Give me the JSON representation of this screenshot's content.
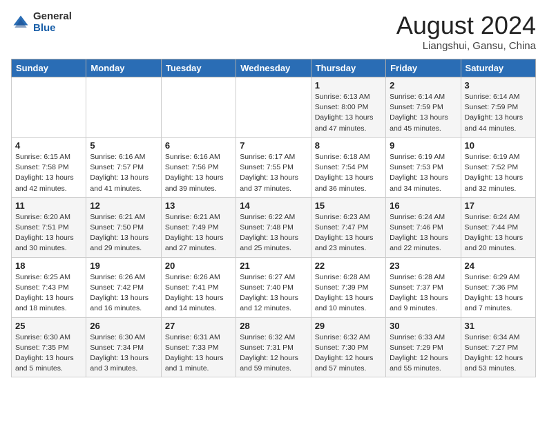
{
  "header": {
    "logo_general": "General",
    "logo_blue": "Blue",
    "month_title": "August 2024",
    "location": "Liangshui, Gansu, China"
  },
  "days_of_week": [
    "Sunday",
    "Monday",
    "Tuesday",
    "Wednesday",
    "Thursday",
    "Friday",
    "Saturday"
  ],
  "weeks": [
    [
      {
        "day": "",
        "info": ""
      },
      {
        "day": "",
        "info": ""
      },
      {
        "day": "",
        "info": ""
      },
      {
        "day": "",
        "info": ""
      },
      {
        "day": "1",
        "info": "Sunrise: 6:13 AM\nSunset: 8:00 PM\nDaylight: 13 hours\nand 47 minutes."
      },
      {
        "day": "2",
        "info": "Sunrise: 6:14 AM\nSunset: 7:59 PM\nDaylight: 13 hours\nand 45 minutes."
      },
      {
        "day": "3",
        "info": "Sunrise: 6:14 AM\nSunset: 7:59 PM\nDaylight: 13 hours\nand 44 minutes."
      }
    ],
    [
      {
        "day": "4",
        "info": "Sunrise: 6:15 AM\nSunset: 7:58 PM\nDaylight: 13 hours\nand 42 minutes."
      },
      {
        "day": "5",
        "info": "Sunrise: 6:16 AM\nSunset: 7:57 PM\nDaylight: 13 hours\nand 41 minutes."
      },
      {
        "day": "6",
        "info": "Sunrise: 6:16 AM\nSunset: 7:56 PM\nDaylight: 13 hours\nand 39 minutes."
      },
      {
        "day": "7",
        "info": "Sunrise: 6:17 AM\nSunset: 7:55 PM\nDaylight: 13 hours\nand 37 minutes."
      },
      {
        "day": "8",
        "info": "Sunrise: 6:18 AM\nSunset: 7:54 PM\nDaylight: 13 hours\nand 36 minutes."
      },
      {
        "day": "9",
        "info": "Sunrise: 6:19 AM\nSunset: 7:53 PM\nDaylight: 13 hours\nand 34 minutes."
      },
      {
        "day": "10",
        "info": "Sunrise: 6:19 AM\nSunset: 7:52 PM\nDaylight: 13 hours\nand 32 minutes."
      }
    ],
    [
      {
        "day": "11",
        "info": "Sunrise: 6:20 AM\nSunset: 7:51 PM\nDaylight: 13 hours\nand 30 minutes."
      },
      {
        "day": "12",
        "info": "Sunrise: 6:21 AM\nSunset: 7:50 PM\nDaylight: 13 hours\nand 29 minutes."
      },
      {
        "day": "13",
        "info": "Sunrise: 6:21 AM\nSunset: 7:49 PM\nDaylight: 13 hours\nand 27 minutes."
      },
      {
        "day": "14",
        "info": "Sunrise: 6:22 AM\nSunset: 7:48 PM\nDaylight: 13 hours\nand 25 minutes."
      },
      {
        "day": "15",
        "info": "Sunrise: 6:23 AM\nSunset: 7:47 PM\nDaylight: 13 hours\nand 23 minutes."
      },
      {
        "day": "16",
        "info": "Sunrise: 6:24 AM\nSunset: 7:46 PM\nDaylight: 13 hours\nand 22 minutes."
      },
      {
        "day": "17",
        "info": "Sunrise: 6:24 AM\nSunset: 7:44 PM\nDaylight: 13 hours\nand 20 minutes."
      }
    ],
    [
      {
        "day": "18",
        "info": "Sunrise: 6:25 AM\nSunset: 7:43 PM\nDaylight: 13 hours\nand 18 minutes."
      },
      {
        "day": "19",
        "info": "Sunrise: 6:26 AM\nSunset: 7:42 PM\nDaylight: 13 hours\nand 16 minutes."
      },
      {
        "day": "20",
        "info": "Sunrise: 6:26 AM\nSunset: 7:41 PM\nDaylight: 13 hours\nand 14 minutes."
      },
      {
        "day": "21",
        "info": "Sunrise: 6:27 AM\nSunset: 7:40 PM\nDaylight: 13 hours\nand 12 minutes."
      },
      {
        "day": "22",
        "info": "Sunrise: 6:28 AM\nSunset: 7:39 PM\nDaylight: 13 hours\nand 10 minutes."
      },
      {
        "day": "23",
        "info": "Sunrise: 6:28 AM\nSunset: 7:37 PM\nDaylight: 13 hours\nand 9 minutes."
      },
      {
        "day": "24",
        "info": "Sunrise: 6:29 AM\nSunset: 7:36 PM\nDaylight: 13 hours\nand 7 minutes."
      }
    ],
    [
      {
        "day": "25",
        "info": "Sunrise: 6:30 AM\nSunset: 7:35 PM\nDaylight: 13 hours\nand 5 minutes."
      },
      {
        "day": "26",
        "info": "Sunrise: 6:30 AM\nSunset: 7:34 PM\nDaylight: 13 hours\nand 3 minutes."
      },
      {
        "day": "27",
        "info": "Sunrise: 6:31 AM\nSunset: 7:33 PM\nDaylight: 13 hours\nand 1 minute."
      },
      {
        "day": "28",
        "info": "Sunrise: 6:32 AM\nSunset: 7:31 PM\nDaylight: 12 hours\nand 59 minutes."
      },
      {
        "day": "29",
        "info": "Sunrise: 6:32 AM\nSunset: 7:30 PM\nDaylight: 12 hours\nand 57 minutes."
      },
      {
        "day": "30",
        "info": "Sunrise: 6:33 AM\nSunset: 7:29 PM\nDaylight: 12 hours\nand 55 minutes."
      },
      {
        "day": "31",
        "info": "Sunrise: 6:34 AM\nSunset: 7:27 PM\nDaylight: 12 hours\nand 53 minutes."
      }
    ]
  ]
}
